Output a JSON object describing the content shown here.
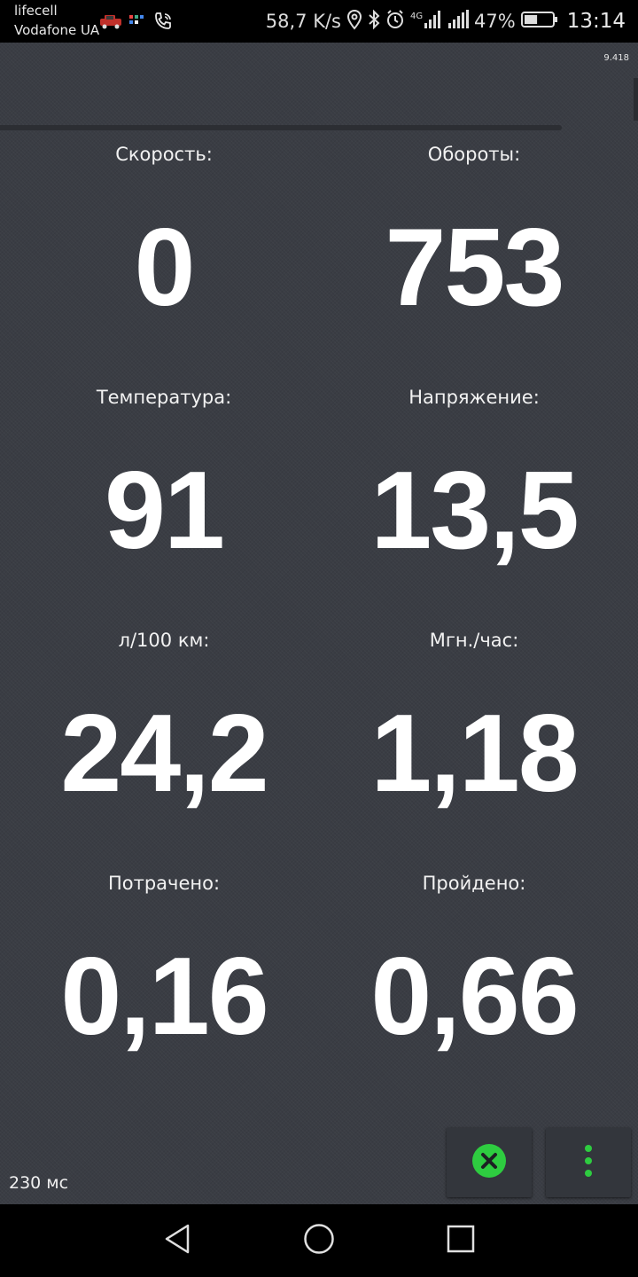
{
  "status_bar": {
    "carrier_primary": "lifecell",
    "carrier_secondary": "Vodafone UA",
    "network_speed": "58,7 K/s",
    "network_type": "4G",
    "battery_percent": "47%",
    "battery_level": 0.47,
    "time": "13:14",
    "icons": [
      "car-notification-icon",
      "sim-icon",
      "call-icon",
      "location-icon",
      "bluetooth-icon",
      "alarm-icon",
      "mobile-data-icon",
      "signal-icon",
      "battery-icon"
    ]
  },
  "app": {
    "version": "9.418",
    "latency": "230 мс",
    "colors": {
      "background": "#3a3d44",
      "value_text": "#ffffff",
      "close_accent": "#2ecc40",
      "menu_accent": "#2ecc40"
    },
    "metrics": [
      {
        "label": "Скорость:",
        "value": "0"
      },
      {
        "label": "Обороты:",
        "value": "753"
      },
      {
        "label": "Температура:",
        "value": "91"
      },
      {
        "label": "Напряжение:",
        "value": "13,5"
      },
      {
        "label": "л/100 км:",
        "value": "24,2"
      },
      {
        "label": "Мгн./час:",
        "value": "1,18"
      },
      {
        "label": "Потрачено:",
        "value": "0,16"
      },
      {
        "label": "Пройдено:",
        "value": "0,66"
      }
    ],
    "buttons": {
      "close_icon": "close-circle-icon",
      "menu_icon": "more-vertical-icon"
    }
  },
  "nav_bar": {
    "icons": [
      "back-icon",
      "home-icon",
      "recents-icon"
    ]
  }
}
